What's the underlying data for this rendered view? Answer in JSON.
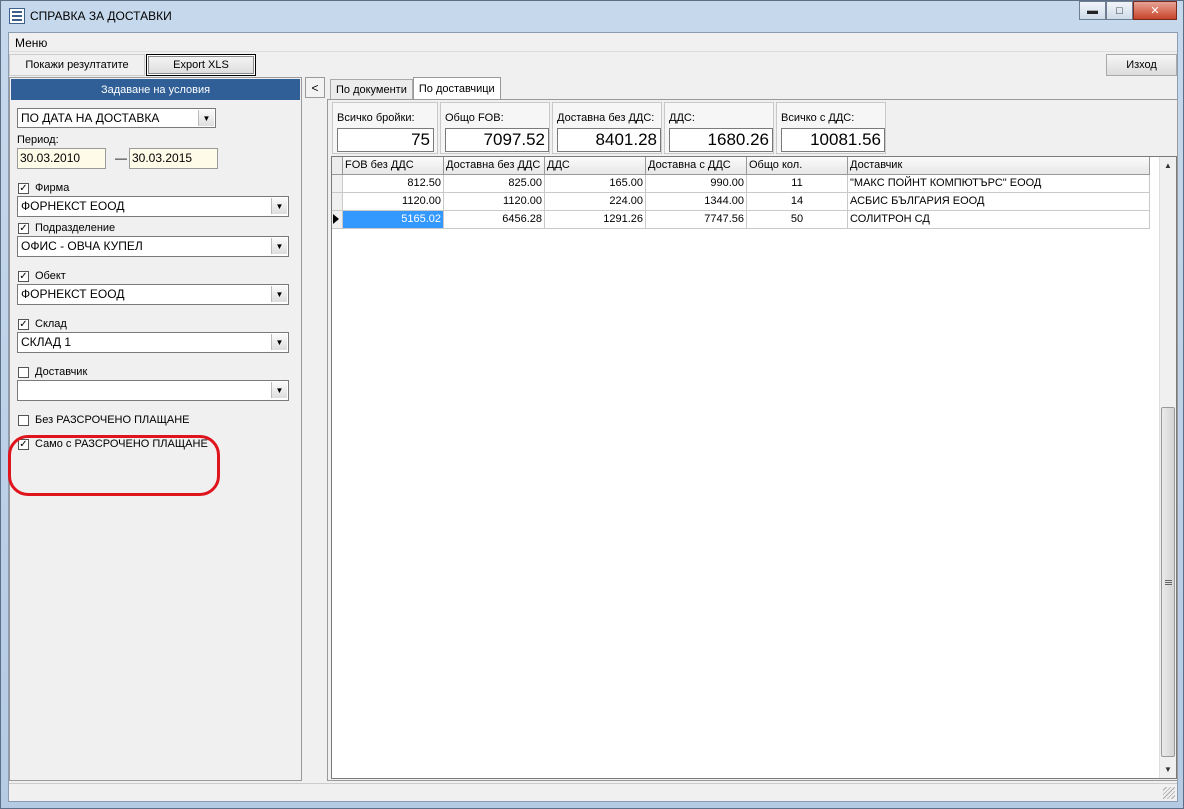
{
  "window": {
    "title": "СПРАВКА ЗА ДОСТАВКИ"
  },
  "menu": {
    "label": "Меню"
  },
  "toolbar": {
    "show_results": "Покажи резултатите",
    "export_xls": "Export XLS",
    "exit": "Изход"
  },
  "left_panel": {
    "header": "Задаване на условия",
    "date_mode": "ПО ДАТА НА ДОСТАВКА",
    "period_label": "Период:",
    "date_from": "30.03.2010",
    "date_sep": "—",
    "date_to": "30.03.2015",
    "firm": {
      "label": "Фирма",
      "checked": true,
      "value": "ФОРНЕКСТ ЕООД"
    },
    "division": {
      "label": "Подразделение",
      "checked": true,
      "value": "ОФИС - ОВЧА КУПЕЛ"
    },
    "object": {
      "label": "Обект",
      "checked": true,
      "value": "ФОРНЕКСТ ЕООД"
    },
    "warehouse": {
      "label": "Склад",
      "checked": true,
      "value": "СКЛАД 1"
    },
    "supplier": {
      "label": "Доставчик",
      "checked": false,
      "value": ""
    },
    "without_installment": {
      "label": "Без РАЗСРОЧЕНО ПЛАЩАНЕ",
      "checked": false
    },
    "only_installment": {
      "label": "Само с РАЗСРОЧЕНО ПЛАЩАНЕ",
      "checked": true
    },
    "collapse_glyph": "<"
  },
  "tabs": [
    {
      "label": "По документи",
      "active": false
    },
    {
      "label": "По доставчици",
      "active": true
    }
  ],
  "summary": {
    "total_qty": {
      "label": "Всичко бройки:",
      "value": "75"
    },
    "total_fob": {
      "label": "Общо FOB:",
      "value": "7097.52"
    },
    "delivery_no_vat": {
      "label": "Доставна без ДДС:",
      "value": "8401.28"
    },
    "vat": {
      "label": "ДДС:",
      "value": "1680.26"
    },
    "total_with_vat": {
      "label": "Всичко с ДДС:",
      "value": "10081.56"
    }
  },
  "grid": {
    "columns": [
      "FOB без ДДС",
      "Доставна без ДДС",
      "ДДС",
      "Доставна с ДДС",
      "Общо кол.",
      "Доставчик"
    ],
    "rows": [
      [
        "812.50",
        "825.00",
        "165.00",
        "990.00",
        "11",
        "\"МАКС ПОЙНТ КОМПЮТЪРС\" ЕООД"
      ],
      [
        "1120.00",
        "1120.00",
        "224.00",
        "1344.00",
        "14",
        "АСБИС БЪЛГАРИЯ ЕООД"
      ],
      [
        "5165.02",
        "6456.28",
        "1291.26",
        "7747.56",
        "50",
        "СОЛИТРОН СД"
      ]
    ],
    "selected_row": 2
  },
  "icons": {
    "app": "report-icon",
    "minimize": "minimize-icon",
    "maximize": "maximize-icon",
    "close": "close-icon"
  },
  "colors": {
    "header_blue": "#2f5f96",
    "selection": "#3399ff",
    "highlight_oval": "#e0141c"
  }
}
